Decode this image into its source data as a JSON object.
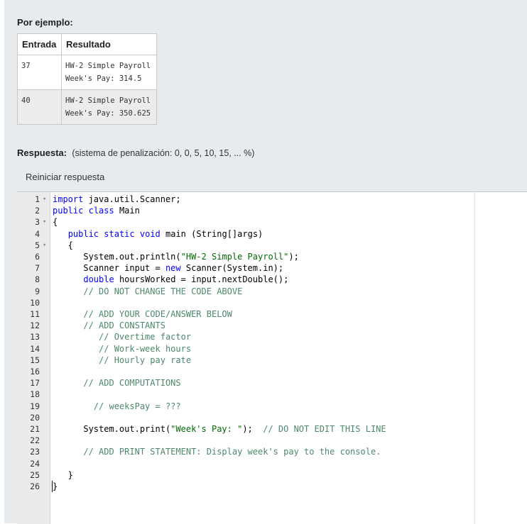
{
  "example": {
    "title": "Por ejemplo:",
    "headers": [
      "Entrada",
      "Resultado"
    ],
    "rows": [
      {
        "input": "37",
        "output": [
          "HW-2 Simple Payroll",
          "Week's Pay: 314.5"
        ]
      },
      {
        "input": "40",
        "output": [
          "HW-2 Simple Payroll",
          "Week's Pay: 350.625"
        ]
      }
    ]
  },
  "answer": {
    "label": "Respuesta:",
    "penalty_note": "(sistema de penalización: 0, 0, 5, 10, 15, ... %)",
    "reset_label": "Reiniciar respuesta"
  },
  "editor": {
    "lines": [
      "import java.util.Scanner;",
      "public class Main",
      "{",
      "   public static void main (String[]args)",
      "   {",
      "      System.out.println(\"HW-2 Simple Payroll\");",
      "      Scanner input = new Scanner(System.in);",
      "      double hoursWorked = input.nextDouble();",
      "      // DO NOT CHANGE THE CODE ABOVE",
      "",
      "      // ADD YOUR CODE/ANSWER BELOW",
      "      // ADD CONSTANTS",
      "         // Overtime factor",
      "         // Work-week hours",
      "         // Hourly pay rate",
      "",
      "      // ADD COMPUTATIONS",
      "",
      "        // weeksPay = ???",
      "",
      "      System.out.print(\"Week's Pay: \");  // DO NOT EDIT THIS LINE",
      "",
      "      // ADD PRINT STATEMENT: Display week's pay to the console.",
      "",
      "   }",
      "}"
    ],
    "fold_lines": [
      1,
      3,
      5
    ],
    "cursor_line": 26
  },
  "colors": {
    "keyword": "#0000ff",
    "string": "#036a07",
    "comment": "#4c886b"
  }
}
